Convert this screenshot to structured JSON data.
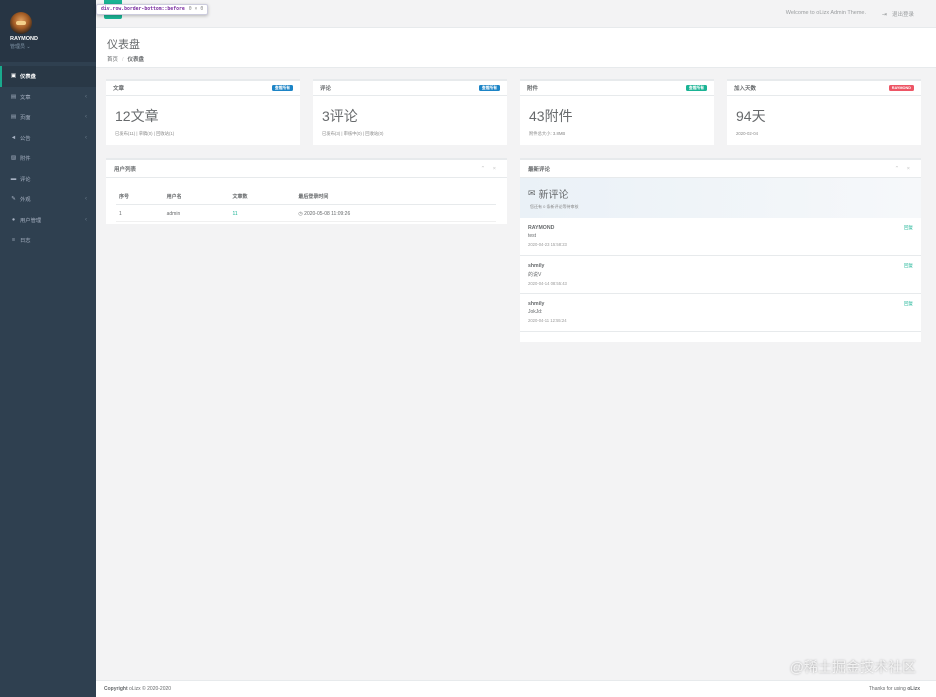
{
  "sidebar": {
    "profile_name": "RAYMOND",
    "profile_role": "管理员",
    "items": [
      {
        "label": "仪表盘",
        "icon": "monitor-icon",
        "glyph": "▣",
        "active": true,
        "arrow": ""
      },
      {
        "label": "文章",
        "icon": "article-icon",
        "glyph": "▤",
        "active": false,
        "arrow": "‹"
      },
      {
        "label": "页面",
        "icon": "page-icon",
        "glyph": "▤",
        "active": false,
        "arrow": "‹"
      },
      {
        "label": "公告",
        "icon": "bullhorn-icon",
        "glyph": "◄",
        "active": false,
        "arrow": "‹"
      },
      {
        "label": "附件",
        "icon": "image-icon",
        "glyph": "▨",
        "active": false,
        "arrow": ""
      },
      {
        "label": "评论",
        "icon": "comment-icon",
        "glyph": "▬",
        "active": false,
        "arrow": ""
      },
      {
        "label": "外观",
        "icon": "brush-icon",
        "glyph": "✎",
        "active": false,
        "arrow": "‹"
      },
      {
        "label": "用户管理",
        "icon": "user-icon",
        "glyph": "●",
        "active": false,
        "arrow": "‹"
      },
      {
        "label": "日志",
        "icon": "log-icon",
        "glyph": "≡",
        "active": false,
        "arrow": ""
      }
    ]
  },
  "topbar": {
    "tooltip_selector": "div.row.border-bottom::before",
    "tooltip_size": "0 × 0",
    "welcome": "Welcome to oLizx Admin Theme.",
    "logout": "退出登录"
  },
  "heading": {
    "title": "仪表盘",
    "crumb_home": "首页",
    "crumb_current": "仪表盘"
  },
  "stats": [
    {
      "title": "文章",
      "badge": "查看所有",
      "badge_color": "#1c84c6",
      "big": "12文章",
      "small": "已发布(11) | 草稿(0) | 回收站(1)"
    },
    {
      "title": "评论",
      "badge": "查看所有",
      "badge_color": "#1c84c6",
      "big": "3评论",
      "small": "已发布(3) | 审核中(0) | 回收站(0)"
    },
    {
      "title": "附件",
      "badge": "查看所有",
      "badge_color": "#1ab394",
      "big": "43附件",
      "small": "附件总大小: 3.8MB"
    },
    {
      "title": "加入天数",
      "badge": "RAYMOND",
      "badge_color": "#ed5565",
      "big": "94天",
      "small": "2020-02-04"
    }
  ],
  "users_panel": {
    "title": "用户列表",
    "tools": "⌃ ×",
    "columns": [
      "序号",
      "用户名",
      "文章数",
      "最后登录时间"
    ],
    "rows": [
      {
        "id": "1",
        "name": "admin",
        "count": "11",
        "time": "◷ 2020-05-08 11:09:26"
      }
    ]
  },
  "comments_panel": {
    "title": "最新评论",
    "tools": "⌃ ×",
    "new_title": "新评论",
    "new_sub": "您还有 0 条新评论等待审核",
    "items": [
      {
        "name": "RAYMOND",
        "text": "test",
        "time": "2020-04-23 15:58:23",
        "reply": "回复"
      },
      {
        "name": "shmily",
        "text": "的说V",
        "time": "2020-04-14 08:55:43",
        "reply": "回复"
      },
      {
        "name": "shmily",
        "text": "JokJd:",
        "time": "2020-04-11 12:55:24",
        "reply": "回复"
      }
    ]
  },
  "footer": {
    "copyright_label": "Copyright",
    "copyright_text": "oLizx © 2020-2020",
    "thanks_text": "Thanks for using",
    "thanks_brand": "oLizx"
  },
  "watermark": "@稀土掘金技术社区",
  "colors": {
    "accent": "#1ab394",
    "sidebar": "#2f4050",
    "blue": "#1c84c6",
    "red": "#ed5565"
  }
}
